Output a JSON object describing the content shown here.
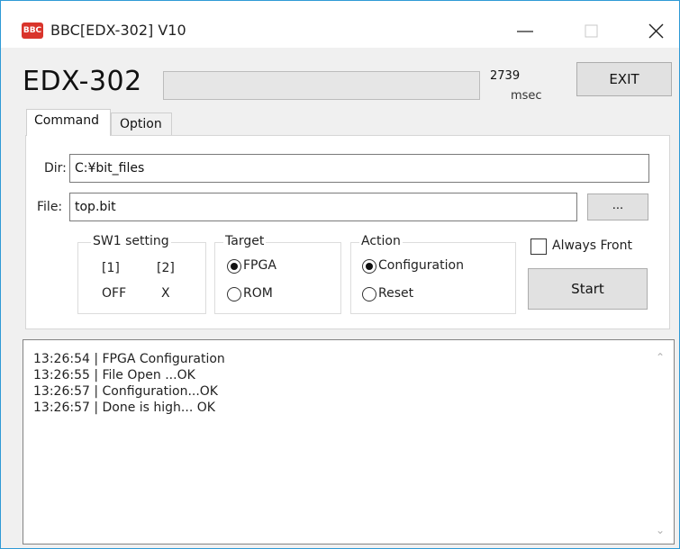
{
  "window": {
    "icon_text": "BBC",
    "title": "BBC[EDX-302] V10",
    "accent_color": "#2f9ad6"
  },
  "header": {
    "device_name": "EDX-302",
    "elapsed_value": "2739",
    "elapsed_unit": "msec",
    "exit_label": "EXIT"
  },
  "tabs": [
    {
      "label": "Command",
      "active": true
    },
    {
      "label": "Option",
      "active": false
    }
  ],
  "form": {
    "dir_label": "Dir:",
    "dir_value": "C:¥bit_files",
    "file_label": "File:",
    "file_value": "top.bit",
    "browse_label": "..."
  },
  "sw1": {
    "title": "SW1 setting",
    "col1_header": "[1]",
    "col2_header": "[2]",
    "col1_value": "OFF",
    "col2_value": "X"
  },
  "target": {
    "title": "Target",
    "options": [
      {
        "label": "FPGA",
        "selected": true
      },
      {
        "label": "ROM",
        "selected": false
      }
    ]
  },
  "action": {
    "title": "Action",
    "options": [
      {
        "label": "Configuration",
        "selected": true
      },
      {
        "label": "Reset",
        "selected": false
      }
    ]
  },
  "always_front": {
    "label": "Always Front",
    "checked": false
  },
  "start_label": "Start",
  "log": {
    "lines": [
      "13:26:54 | FPGA Configuration",
      "13:26:55 | File Open ...OK",
      "13:26:57 | Configuration...OK",
      "13:26:57 | Done is high... OK"
    ]
  }
}
